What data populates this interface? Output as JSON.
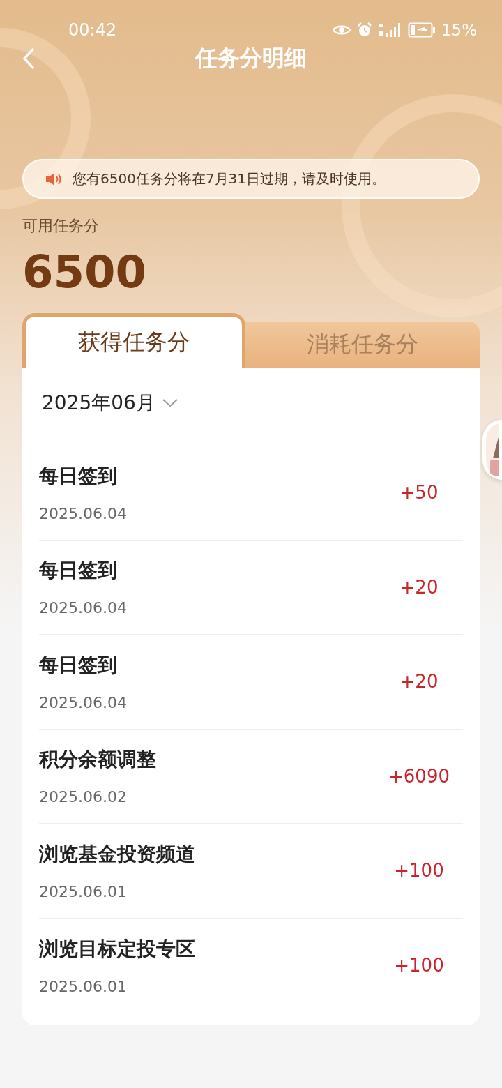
{
  "status_bar": {
    "time": "00:42",
    "battery": "15%"
  },
  "nav": {
    "title": "任务分明细"
  },
  "notice": {
    "text": "您有6500任务分将在7月31日过期，请及时使用。"
  },
  "balance": {
    "label": "可用任务分",
    "value": "6500"
  },
  "tabs": [
    {
      "label": "获得任务分",
      "selected": true
    },
    {
      "label": "消耗任务分",
      "selected": false
    }
  ],
  "month": "2025年06月",
  "records": [
    {
      "title": "每日签到",
      "date": "2025.06.04",
      "points": "+50"
    },
    {
      "title": "每日签到",
      "date": "2025.06.04",
      "points": "+20"
    },
    {
      "title": "每日签到",
      "date": "2025.06.04",
      "points": "+20"
    },
    {
      "title": "积分余额调整",
      "date": "2025.06.02",
      "points": "+6090"
    },
    {
      "title": "浏览基金投资频道",
      "date": "2025.06.01",
      "points": "+100"
    },
    {
      "title": "浏览目标定投专区",
      "date": "2025.06.01",
      "points": "+100"
    }
  ]
}
